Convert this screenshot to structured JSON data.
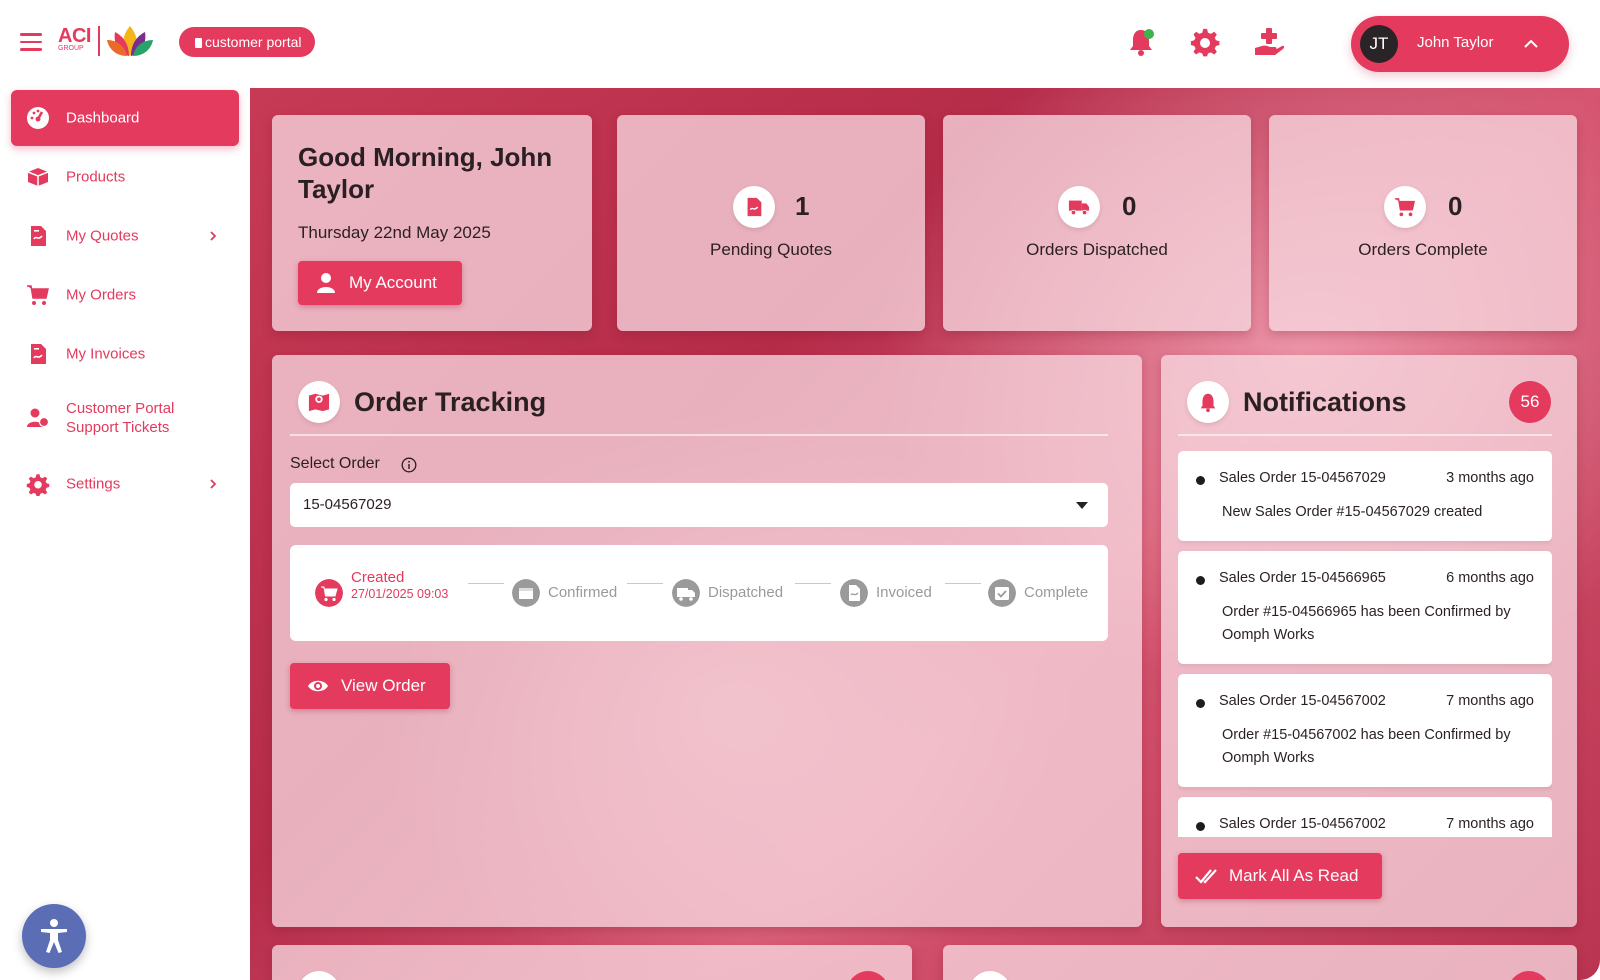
{
  "brand": {
    "logo_text": "ACI",
    "logo_sub": "GROUP",
    "portal_label": "customer portal"
  },
  "header": {
    "user_initials": "JT",
    "user_name": "John Taylor",
    "icons": [
      "bell-icon",
      "gear-icon",
      "hand-plus-icon",
      "chevron-up-icon"
    ]
  },
  "sidebar": {
    "items": [
      {
        "label": "Dashboard",
        "icon": "dashboard-icon",
        "active": true
      },
      {
        "label": "Products",
        "icon": "box-icon"
      },
      {
        "label": "My Quotes",
        "icon": "document-icon",
        "has_submenu": true
      },
      {
        "label": "My Orders",
        "icon": "cart-icon"
      },
      {
        "label": "My Invoices",
        "icon": "invoice-icon"
      },
      {
        "label": "Customer Portal Support Tickets",
        "icon": "support-user-icon"
      },
      {
        "label": "Settings",
        "icon": "gear-icon",
        "has_submenu": true
      }
    ]
  },
  "greeting": {
    "title": "Good Morning, John Taylor",
    "date": "Thursday 22nd May 2025",
    "account_button": "My Account"
  },
  "stats": [
    {
      "value": "1",
      "label": "Pending Quotes",
      "icon": "document-icon"
    },
    {
      "value": "0",
      "label": "Orders Dispatched",
      "icon": "truck-icon"
    },
    {
      "value": "0",
      "label": "Orders Complete",
      "icon": "cart-icon"
    }
  ],
  "order_tracking": {
    "title": "Order Tracking",
    "select_label": "Select Order",
    "selected_order": "15-04567029",
    "steps": [
      {
        "label": "Created",
        "date": "27/01/2025 09:03",
        "done": true
      },
      {
        "label": "Confirmed",
        "done": false
      },
      {
        "label": "Dispatched",
        "done": false
      },
      {
        "label": "Invoiced",
        "done": false
      },
      {
        "label": "Complete",
        "done": false
      }
    ],
    "view_button": "View Order"
  },
  "notifications": {
    "title": "Notifications",
    "count": "56",
    "items": [
      {
        "title": "Sales Order 15-04567029",
        "time": "3 months ago",
        "body": "New Sales Order #15-04567029 created"
      },
      {
        "title": "Sales Order 15-04566965",
        "time": "6 months ago",
        "body": "Order #15-04566965 has been Confirmed by Oomph Works"
      },
      {
        "title": "Sales Order 15-04567002",
        "time": "7 months ago",
        "body": "Order #15-04567002 has been Confirmed by Oomph Works"
      },
      {
        "title": "Sales Order 15-04567002",
        "time": "7 months ago",
        "body": ""
      }
    ],
    "mark_all_button": "Mark All As Read"
  },
  "colors": {
    "accent": "#e43a5e",
    "accessibility": "#5b6db5",
    "status_dot": "#3cb44b"
  }
}
